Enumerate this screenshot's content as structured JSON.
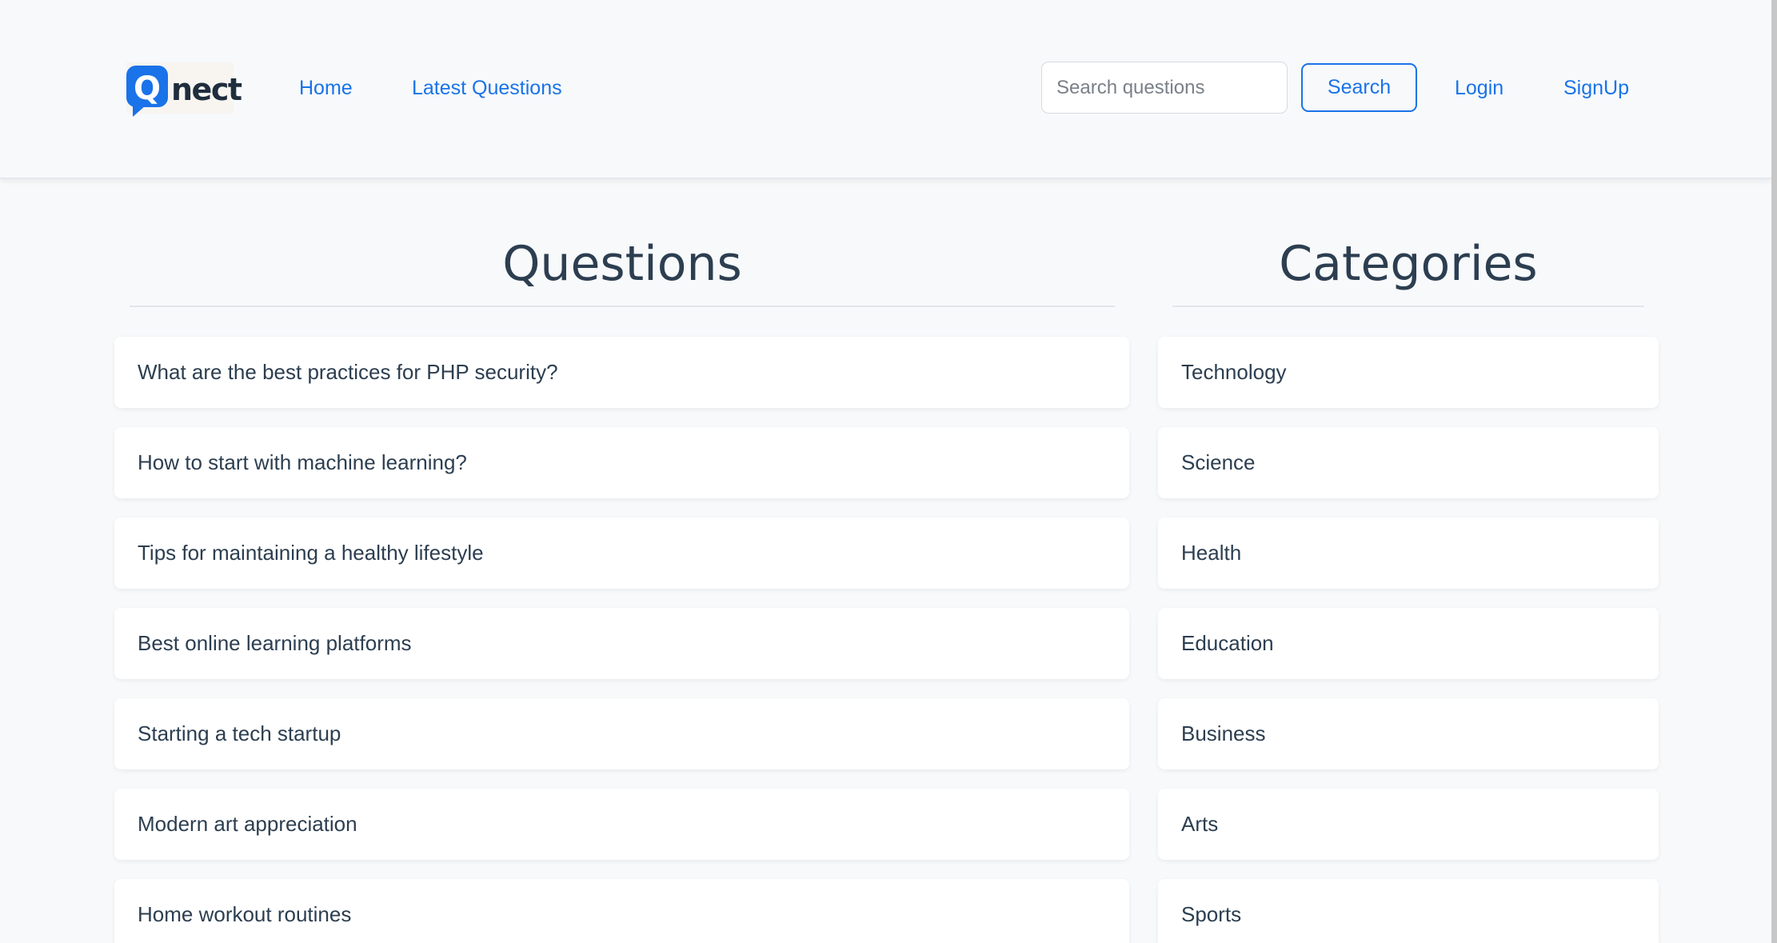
{
  "header": {
    "logo": {
      "letter": "Q",
      "word": "nect",
      "brand_color": "#1a73e8"
    },
    "nav": {
      "home_label": "Home",
      "latest_label": "Latest Questions",
      "login_label": "Login",
      "signup_label": "SignUp"
    },
    "search": {
      "placeholder": "Search questions",
      "value": "",
      "button_label": "Search"
    }
  },
  "main": {
    "questions_title": "Questions",
    "categories_title": "Categories",
    "questions": [
      "What are the best practices for PHP security?",
      "How to start with machine learning?",
      "Tips for maintaining a healthy lifestyle",
      "Best online learning platforms",
      "Starting a tech startup",
      "Modern art appreciation",
      "Home workout routines"
    ],
    "categories": [
      "Technology",
      "Science",
      "Health",
      "Education",
      "Business",
      "Arts",
      "Sports"
    ]
  },
  "colors": {
    "accent": "#1a73e8",
    "text": "#2c3e50",
    "background": "#f7f9fb",
    "card": "#ffffff"
  }
}
